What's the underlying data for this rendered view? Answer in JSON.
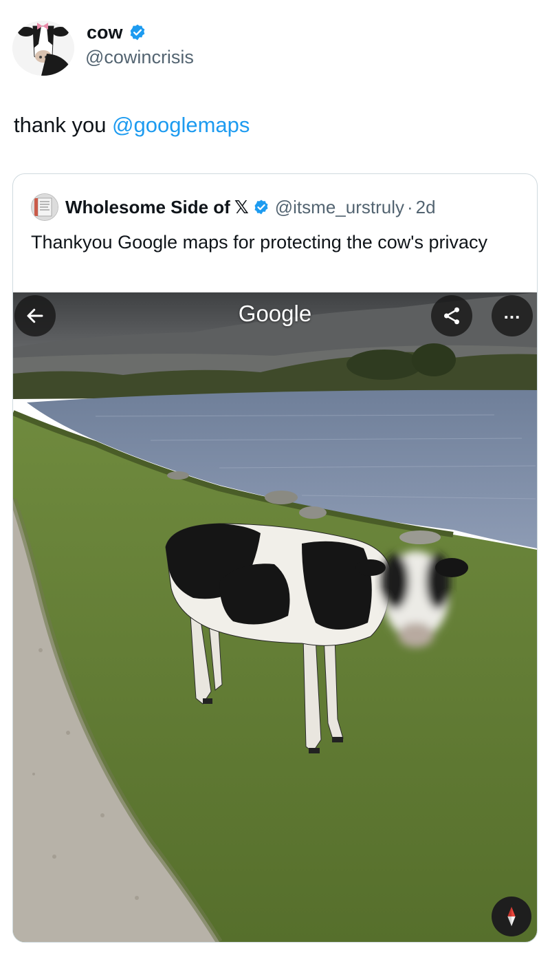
{
  "tweet": {
    "author_name": "cow",
    "author_handle": "@cowincrisis",
    "text_prefix": "thank you ",
    "mention": "@googlemaps"
  },
  "quoted": {
    "author_name": "Wholesome Side of",
    "x_glyph": "𝕏",
    "handle": "@itsme_urstruly",
    "separator": "·",
    "time": "2d",
    "text": "Thankyou Google maps for protecting the cow's privacy"
  },
  "streetview": {
    "label": "Google",
    "back_icon": "arrow-left-icon",
    "share_icon": "share-icon",
    "more_icon": "more-horizontal-icon",
    "more_glyph": "...",
    "compass_icon": "compass-icon"
  },
  "colors": {
    "verified": "#1d9bf0",
    "mention": "#1d9bf0",
    "handle": "#536471"
  }
}
